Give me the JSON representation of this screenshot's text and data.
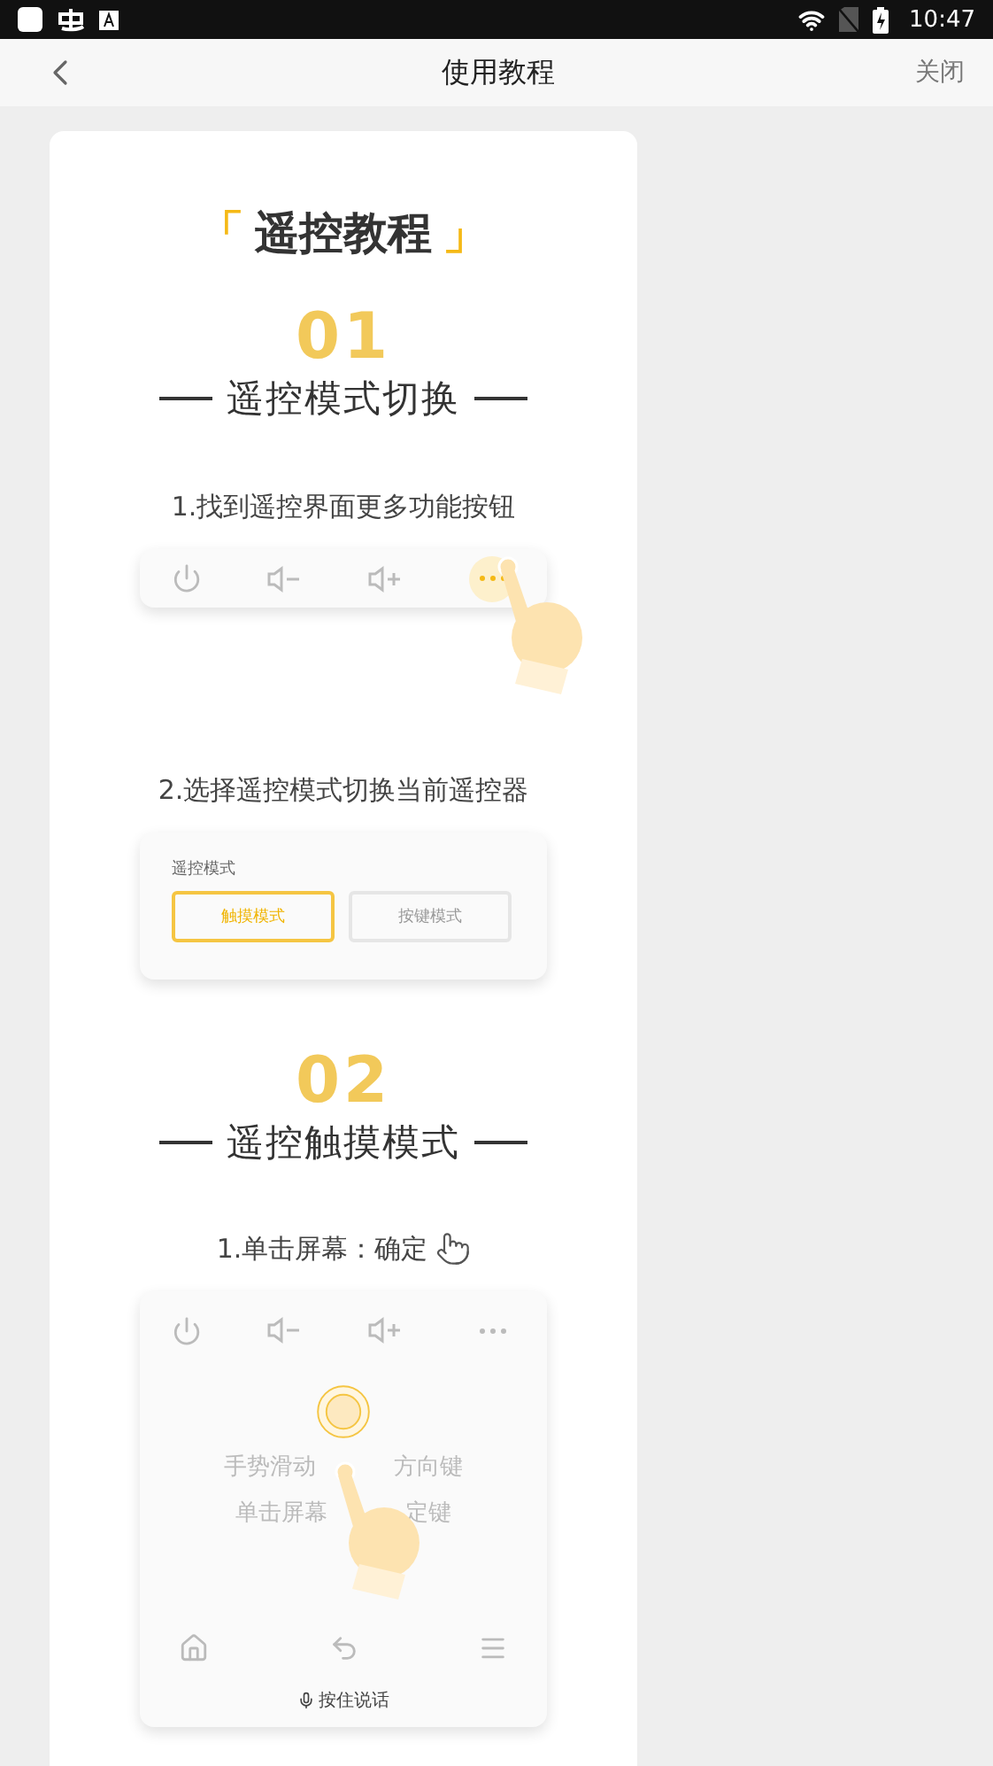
{
  "status_bar": {
    "time": "10:47"
  },
  "nav": {
    "title": "使用教程",
    "close": "关闭"
  },
  "tutorial": {
    "brackets": [
      "「",
      "」"
    ],
    "title": "遥控教程",
    "sections": [
      {
        "number": "01",
        "heading": "遥控模式切换",
        "steps": [
          {
            "kind": "button_bar",
            "text": "1.找到遥控界面更多功能按钮"
          },
          {
            "kind": "mode_panel",
            "text": "2.选择遥控模式切换当前遥控器",
            "panel_label": "遥控模式",
            "modes": [
              {
                "label": "触摸模式",
                "selected": true
              },
              {
                "label": "按键模式",
                "selected": false
              }
            ]
          }
        ]
      },
      {
        "number": "02",
        "heading": "遥控触摸模式",
        "steps": [
          {
            "kind": "touch_pad",
            "text": "1.单击屏幕：确定",
            "hints": [
              {
                "left": "手势滑动",
                "right": "方向键"
              },
              {
                "left": "单击屏幕",
                "right": "定键"
              }
            ],
            "voice": "按住说话"
          }
        ]
      }
    ]
  }
}
